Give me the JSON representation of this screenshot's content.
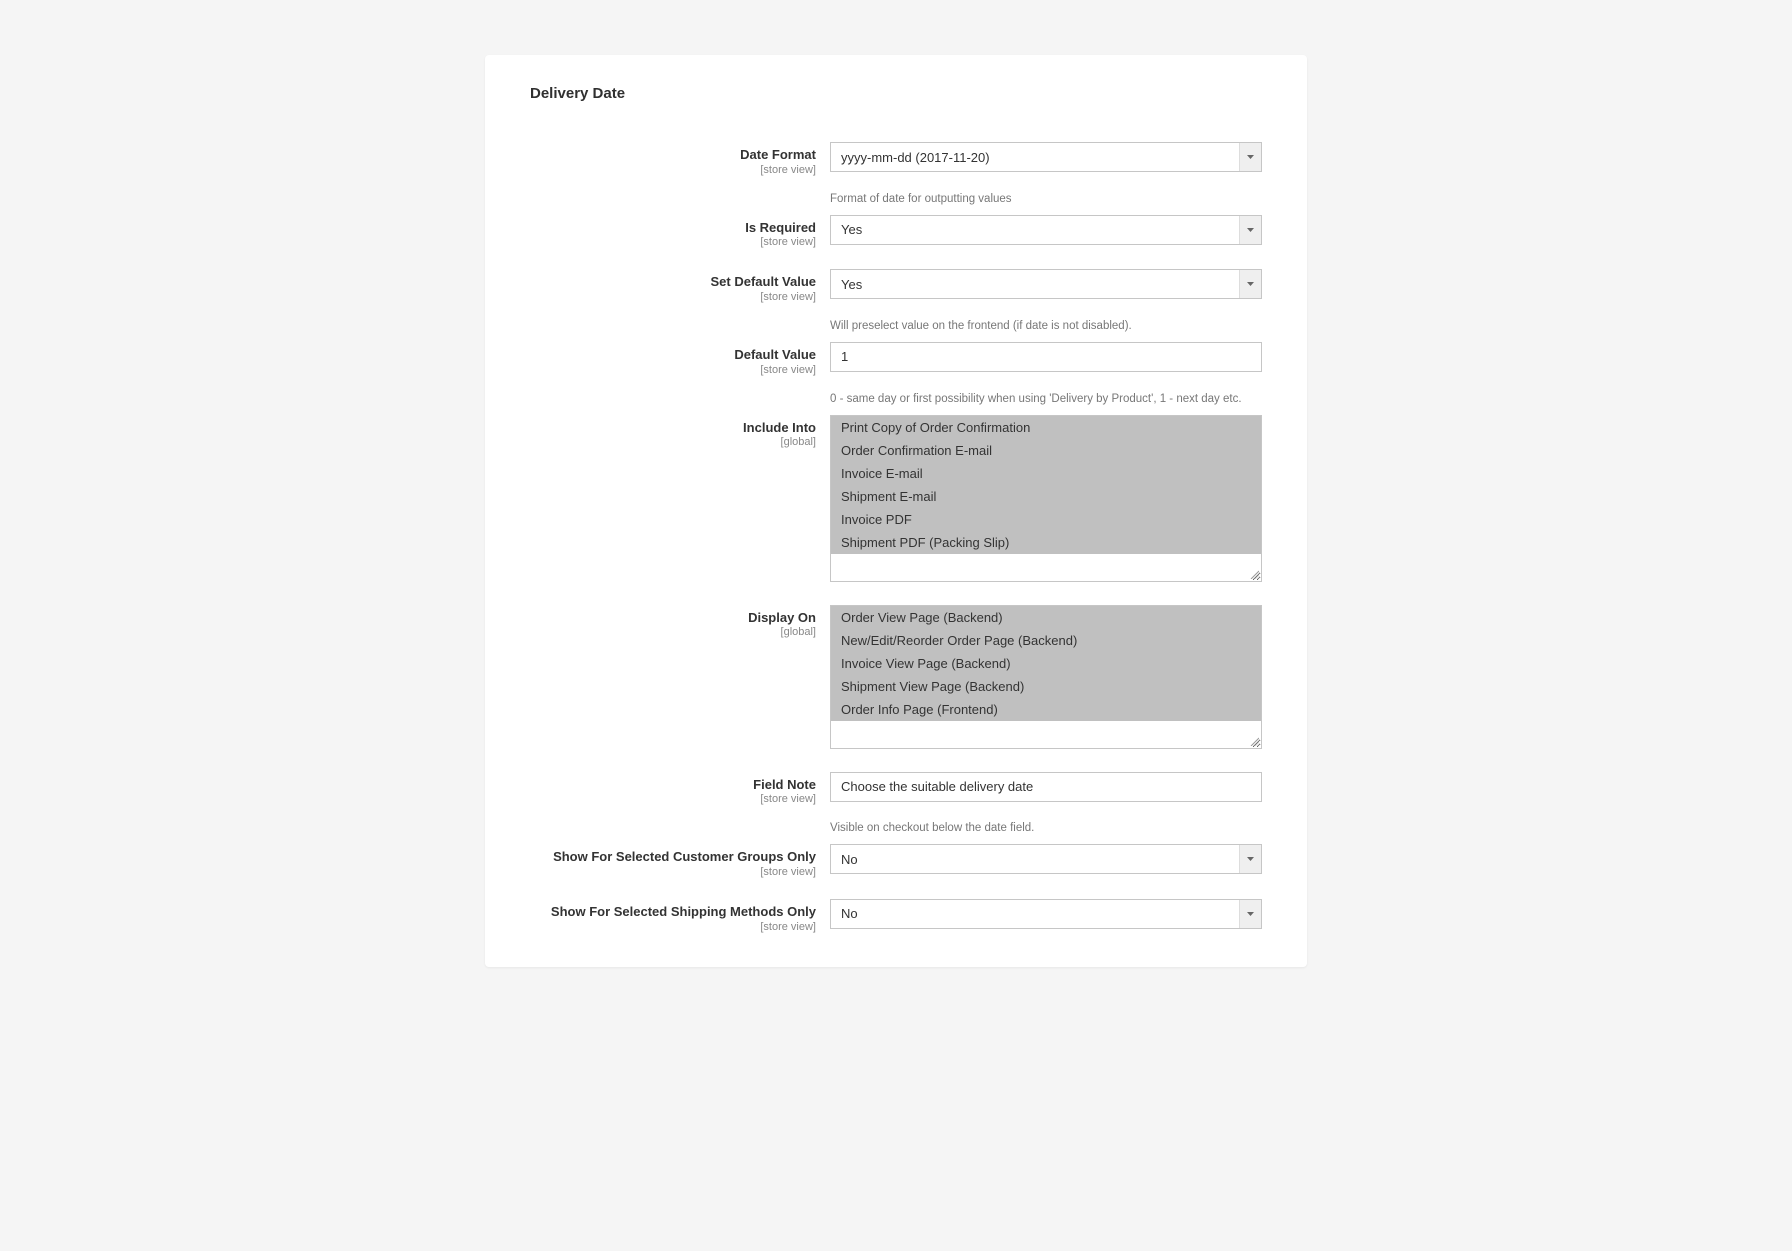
{
  "section_title": "Delivery Date",
  "fields": {
    "date_format": {
      "label": "Date Format",
      "scope": "[store view]",
      "value": "yyyy-mm-dd (2017-11-20)",
      "note": "Format of date for outputting values"
    },
    "is_required": {
      "label": "Is Required",
      "scope": "[store view]",
      "value": "Yes"
    },
    "set_default": {
      "label": "Set Default Value",
      "scope": "[store view]",
      "value": "Yes",
      "note": "Will preselect value on the frontend (if date is not disabled)."
    },
    "default_value": {
      "label": "Default Value",
      "scope": "[store view]",
      "value": "1",
      "note": "0 - same day or first possibility when using 'Delivery by Product', 1 - next day etc."
    },
    "include_into": {
      "label": "Include Into",
      "scope": "[global]",
      "options": [
        "Print Copy of Order Confirmation",
        "Order Confirmation E-mail",
        "Invoice E-mail",
        "Shipment E-mail",
        "Invoice PDF",
        "Shipment PDF (Packing Slip)"
      ]
    },
    "display_on": {
      "label": "Display On",
      "scope": "[global]",
      "options": [
        "Order View Page (Backend)",
        "New/Edit/Reorder Order Page (Backend)",
        "Invoice View Page (Backend)",
        "Shipment View Page (Backend)",
        "Order Info Page (Frontend)"
      ]
    },
    "field_note": {
      "label": "Field Note",
      "scope": "[store view]",
      "value": "Choose the suitable delivery date",
      "note": "Visible on checkout below the date field."
    },
    "customer_groups": {
      "label": "Show For Selected Customer Groups Only",
      "scope": "[store view]",
      "value": "No"
    },
    "shipping_methods": {
      "label": "Show For Selected Shipping Methods Only",
      "scope": "[store view]",
      "value": "No"
    }
  }
}
